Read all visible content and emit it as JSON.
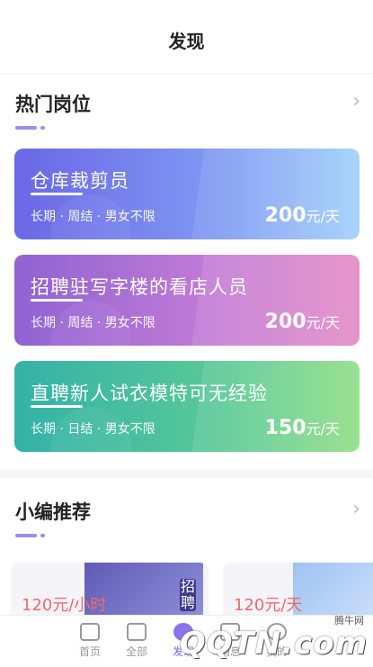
{
  "header": {
    "title": "发现"
  },
  "hot": {
    "title": "热门岗位",
    "more_icon": "chevron-right-icon",
    "jobs": [
      {
        "title": "仓库裁剪员",
        "tags": "长期 · 周结 · 男女不限",
        "price": "200",
        "unit": "元/天"
      },
      {
        "title": "招聘驻写字楼的看店人员",
        "tags": "长期 · 周结 · 男女不限",
        "price": "200",
        "unit": "元/天"
      },
      {
        "title": "直聘新人试衣模特可无经验",
        "tags": "长期 · 日结 · 男女不限",
        "price": "150",
        "unit": "元/天"
      }
    ]
  },
  "recommend": {
    "title": "小编推荐",
    "more_icon": "chevron-right-icon",
    "items": [
      {
        "price": "120元/小时",
        "image_text": "招聘"
      },
      {
        "price": "120元/天"
      }
    ]
  },
  "tabbar": {
    "items": [
      {
        "label": "首页",
        "icon": "home-icon"
      },
      {
        "label": "全部",
        "icon": "list-icon"
      },
      {
        "label": "发现",
        "icon": "discover-icon",
        "active": true
      },
      {
        "label": "消息",
        "icon": "message-icon"
      },
      {
        "label": "我的",
        "icon": "user-icon"
      }
    ]
  },
  "watermark": {
    "logo": "QQTN.com",
    "site": "腾牛网"
  },
  "colors": {
    "accent": "#8b74ea",
    "price_red": "#f06a6a"
  }
}
